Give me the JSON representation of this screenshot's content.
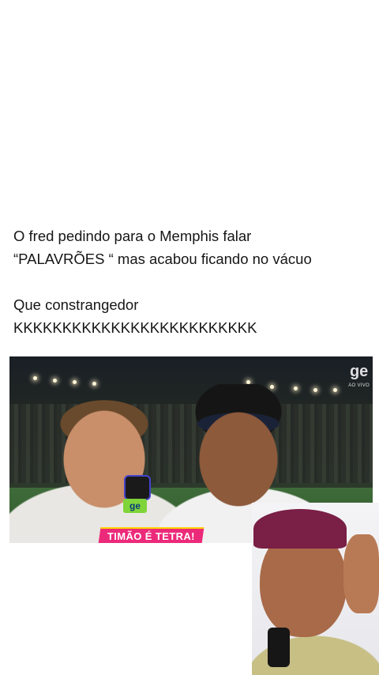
{
  "post": {
    "line1": "O fred pedindo para o Memphis falar",
    "line2": "“PALAVRÕES “ mas acabou ficando no vácuo",
    "line3": "Que constrangedor",
    "line4": "KKKKKKKKKKKKKKKKKKKKKKKKK"
  },
  "video": {
    "broadcaster": "ge",
    "live_label": "AO VIVO",
    "mic_logo": "ge",
    "banner": "TIMÃO É TETRA!",
    "banner_color": "#ec2a7a"
  }
}
